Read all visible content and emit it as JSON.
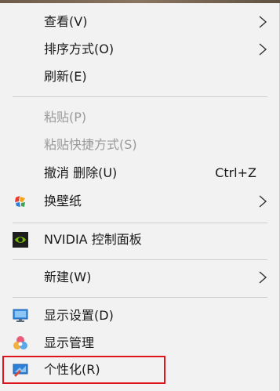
{
  "menu": {
    "items": [
      {
        "label": "查看(V)",
        "submenu": true
      },
      {
        "label": "排序方式(O)",
        "submenu": true
      },
      {
        "label": "刷新(E)"
      },
      {
        "label": "粘贴(P)",
        "disabled": true
      },
      {
        "label": "粘贴快捷方式(S)",
        "disabled": true
      },
      {
        "label": "撤消 删除(U)",
        "shortcut": "Ctrl+Z"
      },
      {
        "label": "换壁纸",
        "submenu": true,
        "icon": "wallpaper-app-icon"
      },
      {
        "label": "NVIDIA 控制面板",
        "icon": "nvidia-icon"
      },
      {
        "label": "新建(W)",
        "submenu": true
      },
      {
        "label": "显示设置(D)",
        "icon": "display-settings-icon"
      },
      {
        "label": "显示管理",
        "icon": "display-manager-icon"
      },
      {
        "label": "个性化(R)",
        "icon": "personalize-icon",
        "highlighted": true
      }
    ],
    "highlight_color": "#e0141b"
  }
}
